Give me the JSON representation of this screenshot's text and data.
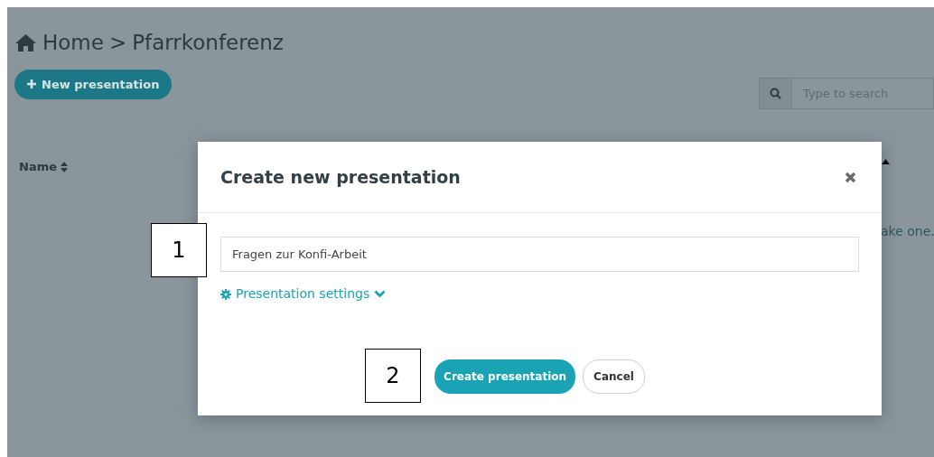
{
  "breadcrumb": {
    "items": [
      "Home",
      "Pfarrkonferenz"
    ],
    "separator": ">"
  },
  "new_button": {
    "label": "New presentation"
  },
  "search": {
    "placeholder": "Type to search"
  },
  "table": {
    "columns": [
      "Name"
    ],
    "empty_text": "ake one."
  },
  "modal": {
    "title": "Create new presentation",
    "input": {
      "value": "Fragen zur Konfi-Arbeit"
    },
    "settings_link": {
      "label": "Presentation settings"
    },
    "buttons": [
      {
        "label": "Create presentation",
        "kind": "primary"
      },
      {
        "label": "Cancel",
        "kind": "secondary"
      }
    ]
  },
  "annotations": [
    "1",
    "2"
  ]
}
